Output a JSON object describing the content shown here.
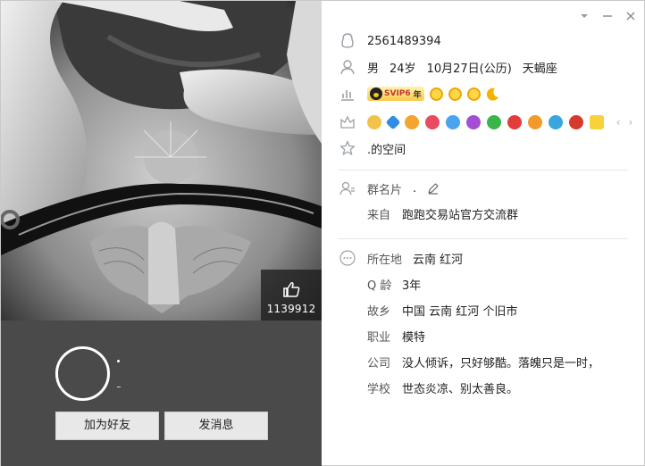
{
  "window": {
    "controls": [
      "dropdown-icon",
      "minimize-icon",
      "close-icon"
    ]
  },
  "photo": {
    "likes": "1139912"
  },
  "profile": {
    "nickname": ".",
    "signature": "-",
    "add_friend_label": "加为好友",
    "send_message_label": "发消息"
  },
  "info": {
    "qq_number": "2561489394",
    "gender": "男",
    "age": "24岁",
    "birthday": "10月27日(公历)",
    "zodiac": "天蝎座",
    "svip_label": "SVIP6",
    "svip_year": "年",
    "space_label": ".的空间"
  },
  "group": {
    "card_label": "群名片",
    "card_value": ".",
    "from_label": "来自",
    "from_value": "跑跑交易站官方交流群"
  },
  "details": {
    "location_label": "所在地",
    "location_value": "云南 红河",
    "qage_label": "Q 龄",
    "qage_value": "3年",
    "hometown_label": "故乡",
    "hometown_value": "中国 云南 红河 个旧市",
    "job_label": "职业",
    "job_value": "模特",
    "company_label": "公司",
    "company_value": "没人倾诉，只好够酷。落魄只是一时，",
    "school_label": "学校",
    "school_value": "世态炎凉、别太善良。"
  },
  "colors": {
    "left_panel": "#4a4a4a",
    "accent_blue": "#3b7bd6",
    "icon_gray": "#9aa0a6"
  }
}
